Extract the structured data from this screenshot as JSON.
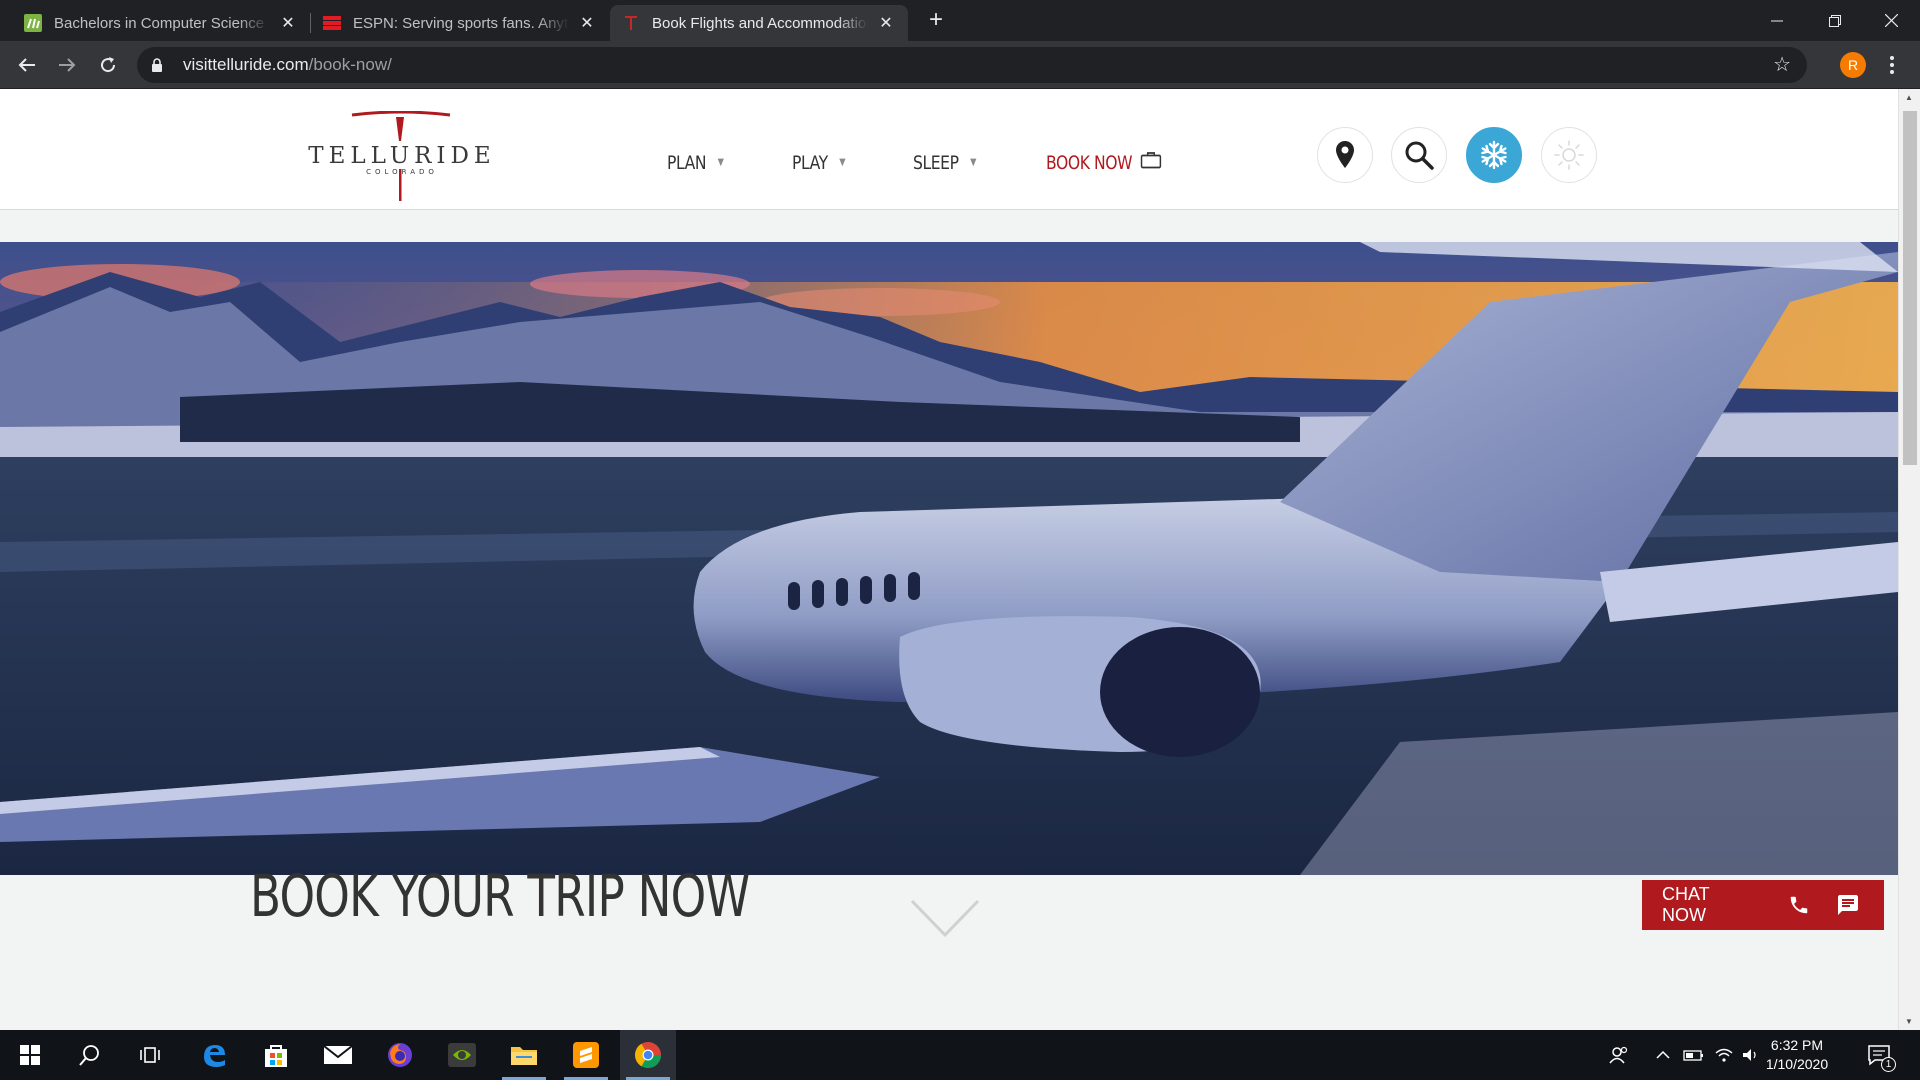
{
  "browser": {
    "tabs": [
      {
        "title": "Bachelors in Computer Science – ",
        "close": "✕"
      },
      {
        "title": "ESPN: Serving sports fans. Anytime. Anywhere.",
        "close": "✕"
      },
      {
        "title": "Book Flights and Accommodations",
        "close": "✕"
      }
    ],
    "new_tab": "+",
    "window_controls": {
      "minimize": "—",
      "restore": "❐",
      "close": "✕"
    },
    "url_host": "visittelluride.com",
    "url_path": "/book-now/",
    "profile_initial": "R"
  },
  "site": {
    "logo": {
      "name": "TELLURIDE",
      "sub": "COLORADO"
    },
    "nav": [
      {
        "label": "PLAN",
        "caret": "▼"
      },
      {
        "label": "PLAY",
        "caret": "▼"
      },
      {
        "label": "SLEEP",
        "caret": "▼"
      },
      {
        "label": "BOOK NOW"
      }
    ],
    "colors": {
      "brand_red": "#b0191e",
      "snow_blue": "#3aa7d6"
    },
    "icons": [
      "map-pin-icon",
      "search-icon",
      "snowflake-icon",
      "sun-icon"
    ]
  },
  "main": {
    "title": "BOOK YOUR TRIP NOW",
    "chat_label": "CHAT NOW"
  },
  "taskbar": {
    "time": "6:32 PM",
    "date": "1/10/2020",
    "notification_count": "1"
  }
}
